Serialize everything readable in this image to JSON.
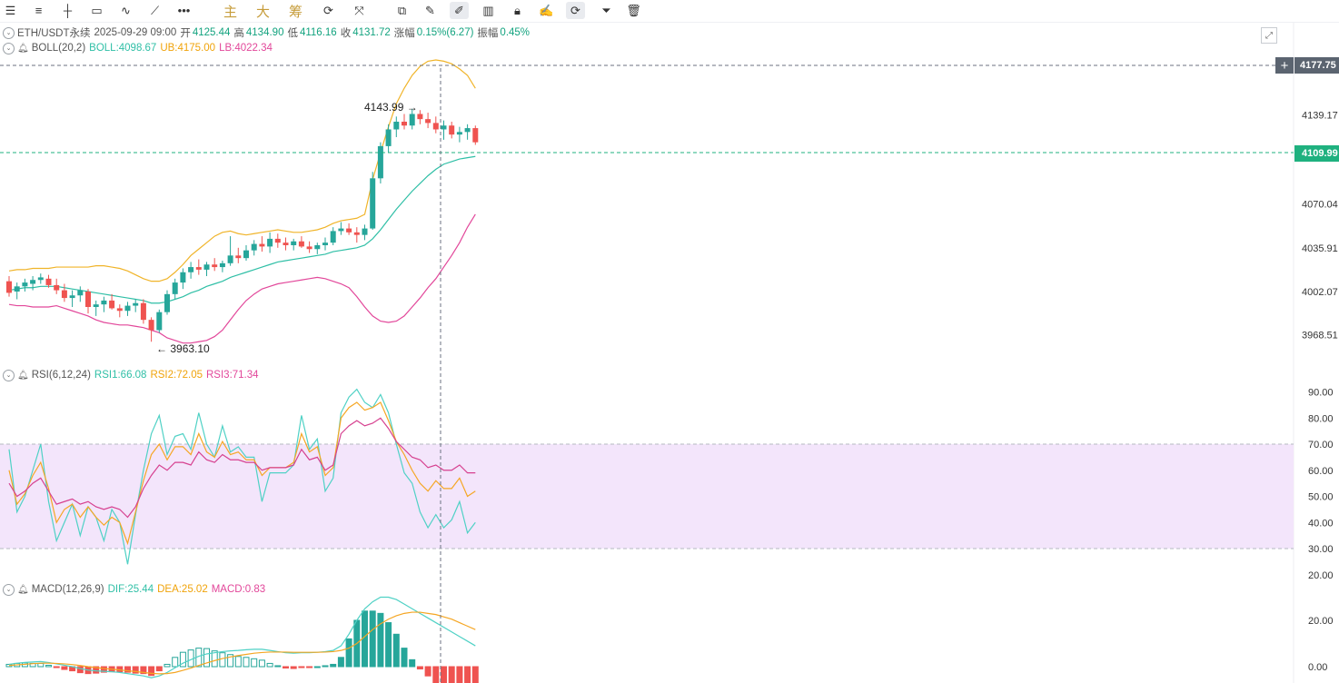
{
  "toolbar": {
    "indicators": [
      "主",
      "大",
      "筹"
    ]
  },
  "legend_price": {
    "symbol": "ETH/USDT永续",
    "datetime": "2025-09-29 09:00",
    "open_label": "开",
    "open": "4125.44",
    "high_label": "高",
    "high": "4134.90",
    "low_label": "低",
    "low": "4116.16",
    "close_label": "收",
    "close": "4131.72",
    "change_label": "涨幅",
    "change": "0.15%(6.27)",
    "amp_label": "振幅",
    "amp": "0.45%"
  },
  "legend_boll": {
    "name": "BOLL(20,2)",
    "boll": "BOLL:4098.67",
    "ub": "UB:4175.00",
    "lb": "LB:4022.34"
  },
  "legend_rsi": {
    "name": "RSI(6,12,24)",
    "rsi1": "RSI1:66.08",
    "rsi2": "RSI2:72.05",
    "rsi3": "RSI3:71.34"
  },
  "legend_macd": {
    "name": "MACD(12,26,9)",
    "dif": "DIF:25.44",
    "dea": "DEA:25.02",
    "macd": "MACD:0.83"
  },
  "price_tags": {
    "crosshair": "4177.75",
    "last": "4109.99"
  },
  "annotations": {
    "high_mark": "4143.99",
    "low_mark": "3963.10"
  },
  "colors": {
    "up": "#26a69a",
    "down": "#ef5350",
    "mid": "#2fbfa6",
    "upper": "#f0b429",
    "lower": "#e2479a",
    "rsi1": "#4fd1c5",
    "rsi2": "#f5a623",
    "rsi3": "#d6408f",
    "rsi_band": "#f3e5fb"
  },
  "chart_data": [
    {
      "type": "candlestick",
      "title": "ETH/USDT永续",
      "ylim": [
        3950,
        4185
      ],
      "y_ticks": [
        "4177.75",
        "4139.17",
        "4109.99",
        "4070.04",
        "4035.91",
        "4002.07",
        "3968.51"
      ],
      "candles": [
        [
          4010,
          4014,
          3998,
          4001
        ],
        [
          4002,
          4009,
          3996,
          4006
        ],
        [
          4006,
          4012,
          4002,
          4009
        ],
        [
          4008,
          4014,
          4003,
          4011
        ],
        [
          4011,
          4016,
          4008,
          4013
        ],
        [
          4012,
          4015,
          4005,
          4007
        ],
        [
          4007,
          4012,
          4000,
          4003
        ],
        [
          4003,
          4008,
          3994,
          3997
        ],
        [
          3997,
          4003,
          3990,
          3999
        ],
        [
          3999,
          4006,
          3994,
          4003
        ],
        [
          4002,
          4004,
          3985,
          3990
        ],
        [
          3990,
          3995,
          3983,
          3992
        ],
        [
          3992,
          3998,
          3986,
          3995
        ],
        [
          3995,
          4000,
          3988,
          3989
        ],
        [
          3989,
          3992,
          3982,
          3987
        ],
        [
          3987,
          3994,
          3983,
          3991
        ],
        [
          3991,
          3996,
          3986,
          3993
        ],
        [
          3993,
          3996,
          3977,
          3980
        ],
        [
          3980,
          3982,
          3963,
          3972
        ],
        [
          3972,
          3988,
          3970,
          3986
        ],
        [
          3986,
          4003,
          3984,
          4000
        ],
        [
          4000,
          4012,
          3996,
          4009
        ],
        [
          4009,
          4020,
          4004,
          4017
        ],
        [
          4017,
          4025,
          4012,
          4021
        ],
        [
          4021,
          4027,
          4015,
          4019
        ],
        [
          4019,
          4025,
          4014,
          4023
        ],
        [
          4023,
          4028,
          4018,
          4021
        ],
        [
          4021,
          4026,
          4017,
          4024
        ],
        [
          4024,
          4045,
          4022,
          4030
        ],
        [
          4030,
          4036,
          4024,
          4028
        ],
        [
          4028,
          4038,
          4026,
          4034
        ],
        [
          4034,
          4042,
          4030,
          4039
        ],
        [
          4039,
          4045,
          4033,
          4037
        ],
        [
          4037,
          4048,
          4032,
          4043
        ],
        [
          4043,
          4047,
          4036,
          4040
        ],
        [
          4040,
          4044,
          4034,
          4038
        ],
        [
          4038,
          4043,
          4034,
          4041
        ],
        [
          4041,
          4045,
          4036,
          4037
        ],
        [
          4037,
          4041,
          4032,
          4035
        ],
        [
          4035,
          4040,
          4031,
          4038
        ],
        [
          4038,
          4044,
          4034,
          4040
        ],
        [
          4040,
          4052,
          4038,
          4049
        ],
        [
          4049,
          4056,
          4046,
          4051
        ],
        [
          4051,
          4055,
          4046,
          4048
        ],
        [
          4048,
          4052,
          4040,
          4046
        ],
        [
          4046,
          4054,
          4042,
          4051
        ],
        [
          4051,
          4095,
          4050,
          4090
        ],
        [
          4090,
          4118,
          4086,
          4115
        ],
        [
          4115,
          4132,
          4110,
          4128
        ],
        [
          4128,
          4138,
          4122,
          4134
        ],
        [
          4134,
          4140,
          4128,
          4131
        ],
        [
          4131,
          4144,
          4128,
          4140
        ],
        [
          4140,
          4143,
          4132,
          4136
        ],
        [
          4136,
          4141,
          4129,
          4133
        ],
        [
          4133,
          4138,
          4125,
          4128
        ],
        [
          4128,
          4135,
          4120,
          4131
        ],
        [
          4131,
          4134,
          4121,
          4124
        ],
        [
          4124,
          4130,
          4118,
          4126
        ],
        [
          4126,
          4132,
          4120,
          4129
        ],
        [
          4129,
          4131,
          4116,
          4118
        ]
      ],
      "boll_mid": [
        4003,
        4004,
        4005,
        4005,
        4006,
        4006,
        4006,
        4005,
        4004,
        4003,
        4002,
        4001,
        4000,
        3999,
        3998,
        3997,
        3996,
        3995,
        3993,
        3993,
        3994,
        3996,
        3998,
        4001,
        4003,
        4006,
        4008,
        4010,
        4013,
        4015,
        4017,
        4019,
        4021,
        4023,
        4025,
        4026,
        4027,
        4028,
        4029,
        4030,
        4031,
        4033,
        4034,
        4035,
        4036,
        4038,
        4043,
        4050,
        4058,
        4066,
        4073,
        4080,
        4086,
        4092,
        4097,
        4101,
        4103,
        4105,
        4106,
        4107
      ],
      "boll_upper": [
        4018,
        4019,
        4019,
        4020,
        4020,
        4020,
        4021,
        4021,
        4021,
        4021,
        4021,
        4022,
        4022,
        4021,
        4020,
        4018,
        4015,
        4012,
        4010,
        4010,
        4012,
        4017,
        4023,
        4030,
        4035,
        4040,
        4045,
        4048,
        4049,
        4047,
        4046,
        4047,
        4048,
        4049,
        4050,
        4049,
        4048,
        4048,
        4049,
        4050,
        4052,
        4055,
        4057,
        4058,
        4059,
        4062,
        4089,
        4110,
        4130,
        4148,
        4160,
        4170,
        4177,
        4181,
        4182,
        4181,
        4179,
        4175,
        4170,
        4160
      ],
      "boll_lower": [
        3992,
        3991,
        3991,
        3990,
        3990,
        3990,
        3991,
        3989,
        3987,
        3985,
        3983,
        3980,
        3978,
        3977,
        3976,
        3976,
        3975,
        3974,
        3972,
        3970,
        3966,
        3964,
        3962,
        3962,
        3963,
        3964,
        3967,
        3972,
        3980,
        3988,
        3995,
        4000,
        4004,
        4006,
        4008,
        4009,
        4010,
        4011,
        4012,
        4013,
        4012,
        4010,
        4008,
        4005,
        3998,
        3990,
        3983,
        3979,
        3978,
        3979,
        3983,
        3990,
        3997,
        4005,
        4012,
        4021,
        4030,
        4040,
        4052,
        4062
      ]
    },
    {
      "type": "line",
      "title": "RSI(6,12,24)",
      "ylim": [
        15,
        95
      ],
      "y_ticks": [
        "90.00",
        "80.00",
        "70.00",
        "60.00",
        "50.00",
        "40.00",
        "30.00",
        "20.00"
      ],
      "band": [
        30,
        70
      ],
      "series": [
        {
          "name": "RSI1",
          "values": [
            68,
            44,
            50,
            60,
            70,
            48,
            33,
            40,
            47,
            35,
            46,
            42,
            33,
            45,
            40,
            24,
            43,
            60,
            74,
            81,
            66,
            73,
            74,
            68,
            82,
            70,
            65,
            77,
            67,
            69,
            65,
            65,
            48,
            59,
            59,
            59,
            62,
            81,
            68,
            72,
            52,
            57,
            82,
            88,
            91,
            86,
            84,
            89,
            82,
            70,
            59,
            55,
            44,
            38,
            43,
            38,
            41,
            48,
            36,
            40
          ]
        },
        {
          "name": "RSI2",
          "values": [
            60,
            47,
            51,
            58,
            63,
            53,
            40,
            45,
            47,
            42,
            46,
            42,
            39,
            42,
            40,
            32,
            44,
            56,
            66,
            70,
            64,
            69,
            69,
            66,
            74,
            67,
            65,
            71,
            66,
            67,
            64,
            64,
            58,
            61,
            61,
            61,
            63,
            74,
            67,
            69,
            58,
            61,
            80,
            84,
            86,
            83,
            84,
            86,
            79,
            71,
            66,
            60,
            55,
            52,
            56,
            53,
            53,
            57,
            50,
            52
          ]
        },
        {
          "name": "RSI3",
          "values": [
            55,
            50,
            52,
            55,
            57,
            52,
            47,
            48,
            49,
            47,
            48,
            46,
            45,
            46,
            45,
            42,
            46,
            53,
            58,
            62,
            60,
            63,
            63,
            62,
            67,
            64,
            63,
            66,
            64,
            64,
            63,
            63,
            60,
            61,
            61,
            61,
            62,
            68,
            64,
            65,
            60,
            62,
            74,
            77,
            79,
            77,
            78,
            80,
            76,
            71,
            68,
            65,
            64,
            61,
            62,
            60,
            60,
            62,
            59,
            59
          ]
        }
      ]
    },
    {
      "type": "bar",
      "title": "MACD(12,26,9)",
      "ylim": [
        -8,
        32
      ],
      "y_ticks": [
        "20.00",
        "0.00"
      ],
      "series": [
        {
          "name": "DIF",
          "values": [
            1,
            1.5,
            1.8,
            2,
            2.2,
            1.8,
            1.2,
            0.6,
            0,
            -0.8,
            -1.5,
            -1.8,
            -2,
            -2.2,
            -2.5,
            -3,
            -3.5,
            -4,
            -4.8,
            -4,
            -2.5,
            -0.5,
            1.5,
            3,
            4.5,
            5.5,
            6,
            6.5,
            6.8,
            7,
            7.3,
            7.5,
            7.5,
            7,
            6.5,
            6,
            5.8,
            6,
            6,
            6.2,
            6.5,
            7,
            9,
            14,
            20,
            25,
            28,
            30,
            30,
            29,
            27,
            25,
            23,
            21,
            19,
            17,
            15,
            13,
            11,
            9
          ]
        },
        {
          "name": "DEA",
          "values": [
            0.5,
            0.8,
            1,
            1.3,
            1.5,
            1.5,
            1.4,
            1.2,
            0.9,
            0.5,
            0,
            -0.4,
            -0.8,
            -1.1,
            -1.4,
            -1.8,
            -2.1,
            -2.5,
            -2.9,
            -3.1,
            -3,
            -2.5,
            -1.6,
            -0.6,
            0.5,
            1.6,
            2.6,
            3.5,
            4.2,
            4.8,
            5.3,
            5.8,
            6.1,
            6.3,
            6.3,
            6.3,
            6.2,
            6.2,
            6.2,
            6.2,
            6.3,
            6.5,
            7,
            8,
            10,
            13,
            16,
            18.5,
            20.5,
            22,
            23,
            23.5,
            23.5,
            23,
            22.5,
            21.5,
            20.5,
            19,
            17.5,
            16
          ]
        },
        {
          "name": "MACD",
          "values": [
            1,
            1.4,
            1.6,
            1.4,
            1.4,
            0.6,
            -0.4,
            -1.2,
            -1.8,
            -2.6,
            -3,
            -2.8,
            -2.4,
            -2.2,
            -2.2,
            -2.4,
            -2.8,
            -3,
            -3.8,
            -1.8,
            1,
            4,
            6.2,
            7.2,
            8,
            7.8,
            6.8,
            6,
            5.2,
            4.4,
            4,
            3.4,
            2.8,
            1.4,
            0.4,
            -0.6,
            -0.8,
            -0.4,
            -0.4,
            0,
            0.4,
            1,
            4,
            12,
            20,
            24,
            24,
            23,
            19,
            14,
            8,
            3,
            -1,
            -4,
            -7,
            -9,
            -11,
            -12,
            -13,
            -14
          ]
        }
      ]
    }
  ]
}
